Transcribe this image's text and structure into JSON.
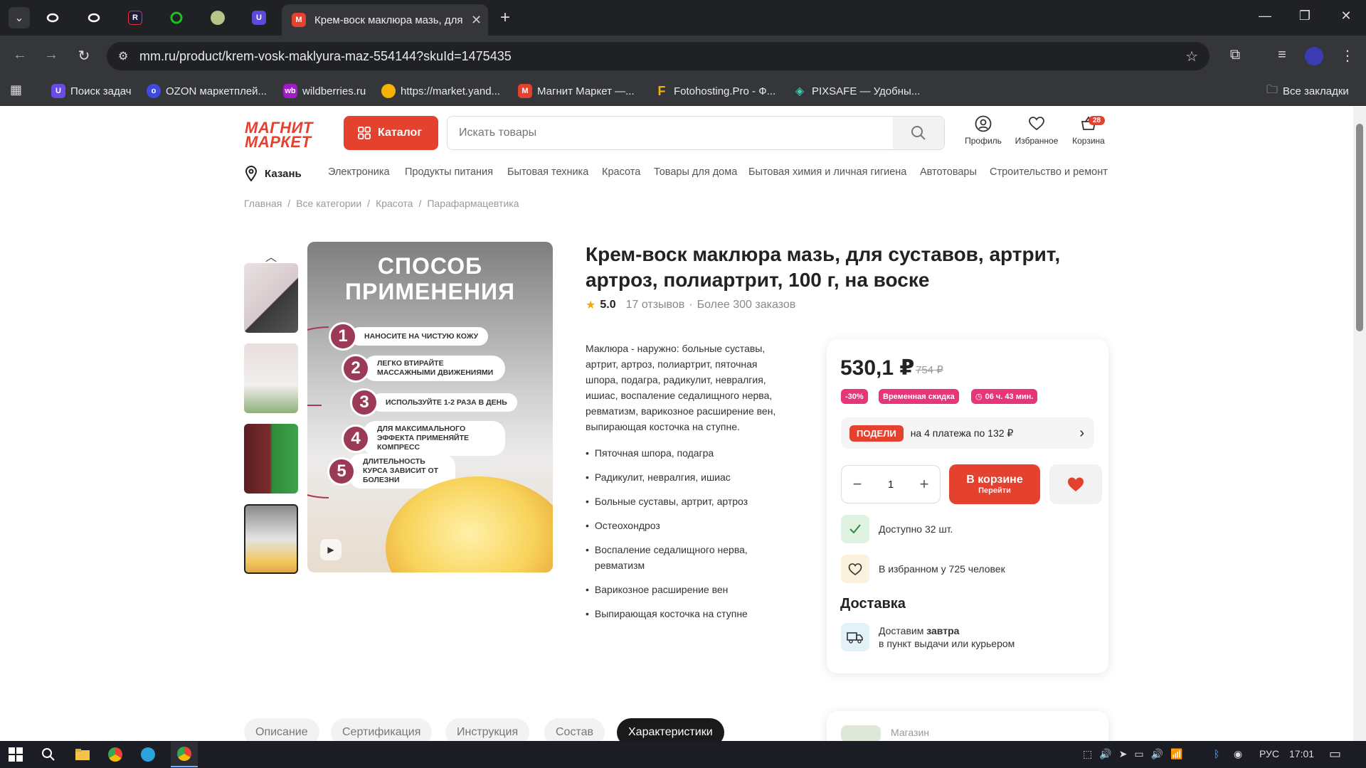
{
  "browser": {
    "active_tab_title": "Крем-воск маклюра мазь, для",
    "url": "mm.ru/product/krem-vosk-maklyura-maz-554144?skuId=1475435",
    "bookmarks": [
      {
        "label": "Поиск задач"
      },
      {
        "label": "OZON маркетплей..."
      },
      {
        "label": "wildberries.ru"
      },
      {
        "label": "https://market.yand..."
      },
      {
        "label": "Магнит Маркет —..."
      },
      {
        "label": "Fotohosting.Pro - Ф..."
      },
      {
        "label": "PIXSAFE — Удобны..."
      }
    ],
    "all_bookmarks": "Все закладки"
  },
  "site": {
    "logo_line1": "МАГНИТ",
    "logo_line2": "МАРКЕТ",
    "catalog_label": "Каталог",
    "search_placeholder": "Искать товары",
    "header_icons": {
      "profile": "Профиль",
      "favorites": "Избранное",
      "cart": "Корзина",
      "cart_count": "28"
    },
    "city": "Казань",
    "nav": [
      "Электроника",
      "Продукты питания",
      "Бытовая техника",
      "Красота",
      "Товары для дома",
      "Бытовая химия и личная гигиена",
      "Автотовары",
      "Строительство и ремонт"
    ],
    "breadcrumbs": [
      "Главная",
      "Все категории",
      "Красота",
      "Парафармацевтика"
    ]
  },
  "gallery": {
    "title_line1": "СПОСОБ",
    "title_line2": "ПРИМЕНЕНИЯ",
    "steps": [
      {
        "num": "1",
        "text": "НАНОСИТЕ НА ЧИСТУЮ КОЖУ"
      },
      {
        "num": "2",
        "text": "ЛЕГКО ВТИРАЙТЕ МАССАЖНЫМИ ДВИЖЕНИЯМИ"
      },
      {
        "num": "3",
        "text": "ИСПОЛЬЗУЙТЕ 1-2 РАЗА В ДЕНЬ"
      },
      {
        "num": "4",
        "text": "ДЛЯ МАКСИМАЛЬНОГО ЭФФЕКТА ПРИМЕНЯЙТЕ КОМПРЕСС"
      },
      {
        "num": "5",
        "text": "ДЛИТЕЛЬНОСТЬ КУРСА ЗАВИСИТ ОТ БОЛЕЗНИ"
      }
    ]
  },
  "product": {
    "title": "Крем-воск маклюра мазь, для суставов, артрит, артроз, полиартрит, 100 г, на воске",
    "rating": "5.0",
    "reviews": "17 отзывов",
    "orders": "Более 300 заказов",
    "description": "Маклюра - наружно: больные суставы, артрит, артроз, полиартрит, пяточная шпора, подагра, радикулит, невралгия, ишиас, воспаление седалищного нерва, ревматизм, варикозное расширение вен, выпирающая косточка на ступне.",
    "bullets": [
      "Пяточная шпора, подагра",
      "Радикулит, невралгия, ишиас",
      "Больные суставы, артрит, артроз",
      "Остеохондроз",
      "Воспаление седалищного нерва, ревматизм",
      "Варикозное расширение вен",
      "Выпирающая косточка на ступне"
    ]
  },
  "buy": {
    "price": "530,1 ₽",
    "old_price": "754 ₽",
    "discount": "-30%",
    "temp_discount": "Временная скидка",
    "timer": "06 ч. 43 мин.",
    "podeli_logo": "ПОДЕЛИ",
    "podeli_text": "на 4 платежа по 132 ₽",
    "qty": "1",
    "cart_main": "В корзине",
    "cart_sub": "Перейти",
    "available": "Доступно 32 шт.",
    "in_favorites": "В избранном у 725 человек",
    "delivery_title": "Доставка",
    "delivery_prefix": "Доставим",
    "delivery_bold": "завтра",
    "delivery_sub": "в пункт выдачи или курьером"
  },
  "tabs": [
    "Описание",
    "Сертификация",
    "Инструкция",
    "Состав",
    "Характеристики"
  ],
  "shop_label": "Магазин",
  "taskbar": {
    "lang": "РУС",
    "time": "17:01"
  },
  "colors": {
    "brand": "#e4412f",
    "badge_pink": "#e8357a",
    "dark": "#1a1a1a"
  }
}
